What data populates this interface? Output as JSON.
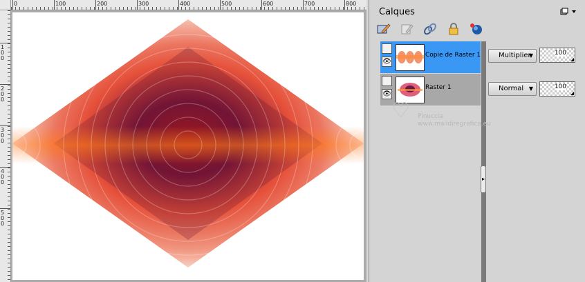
{
  "ruler": {
    "top_labels": [
      "0",
      "100",
      "200",
      "300",
      "400",
      "500",
      "600",
      "700",
      "800"
    ],
    "left_labels": [
      "100",
      "200",
      "300",
      "400",
      "500"
    ]
  },
  "panel": {
    "title": "Calques",
    "toolbar_icons": [
      "edit-layer-icon",
      "properties-icon",
      "link-icon",
      "lock-icon",
      "mask-icon"
    ],
    "layers": [
      {
        "name": "Copie de Raster 1",
        "blend_mode": "Multiplier",
        "opacity": "100",
        "selected": true
      },
      {
        "name": "Raster 1",
        "blend_mode": "Normal",
        "opacity": "100",
        "selected": false
      }
    ]
  },
  "watermark": {
    "line1": "Pinuccia",
    "line2": "www.maildiregrafica.eu"
  },
  "colors": {
    "selection": "#3a97f4",
    "panel_bg": "#d4d4d4",
    "canvas_bg": "#ababab"
  }
}
